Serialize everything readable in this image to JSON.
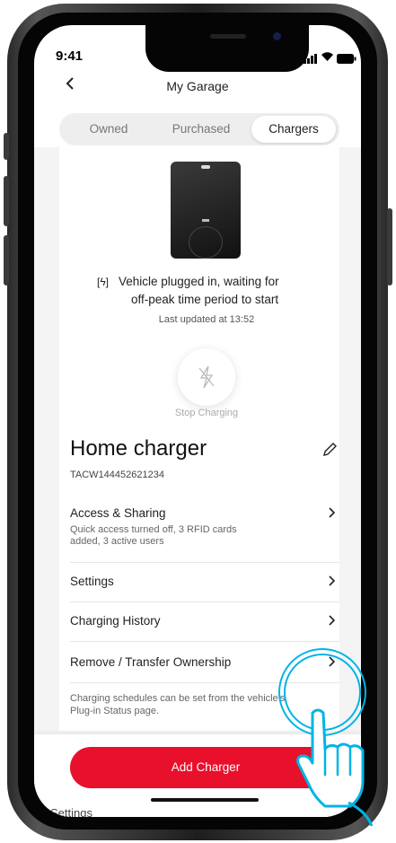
{
  "status_bar": {
    "time": "9:41"
  },
  "header": {
    "title": "My Garage"
  },
  "tabs": [
    {
      "label": "Owned",
      "active": false
    },
    {
      "label": "Purchased",
      "active": false
    },
    {
      "label": "Chargers",
      "active": true
    }
  ],
  "charger_status": {
    "line1": "Vehicle plugged in, waiting for",
    "line2": "off-peak time period to start",
    "updated": "Last updated at 13:52"
  },
  "stop_charging": {
    "label": "Stop Charging"
  },
  "charger": {
    "name": "Home charger",
    "serial": "TACW144452621234"
  },
  "menu": [
    {
      "label": "Access & Sharing",
      "sub1": "Quick access turned off, 3 RFID cards",
      "sub2": "added, 3 active users"
    },
    {
      "label": "Settings"
    },
    {
      "label": "Charging History"
    },
    {
      "label": "Remove / Transfer Ownership"
    }
  ],
  "note": {
    "line1": "Charging schedules can be set from the vehicle's",
    "line2": "Plug-in Status page."
  },
  "add_button": {
    "label": "Add Charger"
  },
  "peek_text": "Settings",
  "colors": {
    "accent": "#e8102b",
    "hint": "#00b4e6",
    "marker": "#1e6fe8"
  }
}
